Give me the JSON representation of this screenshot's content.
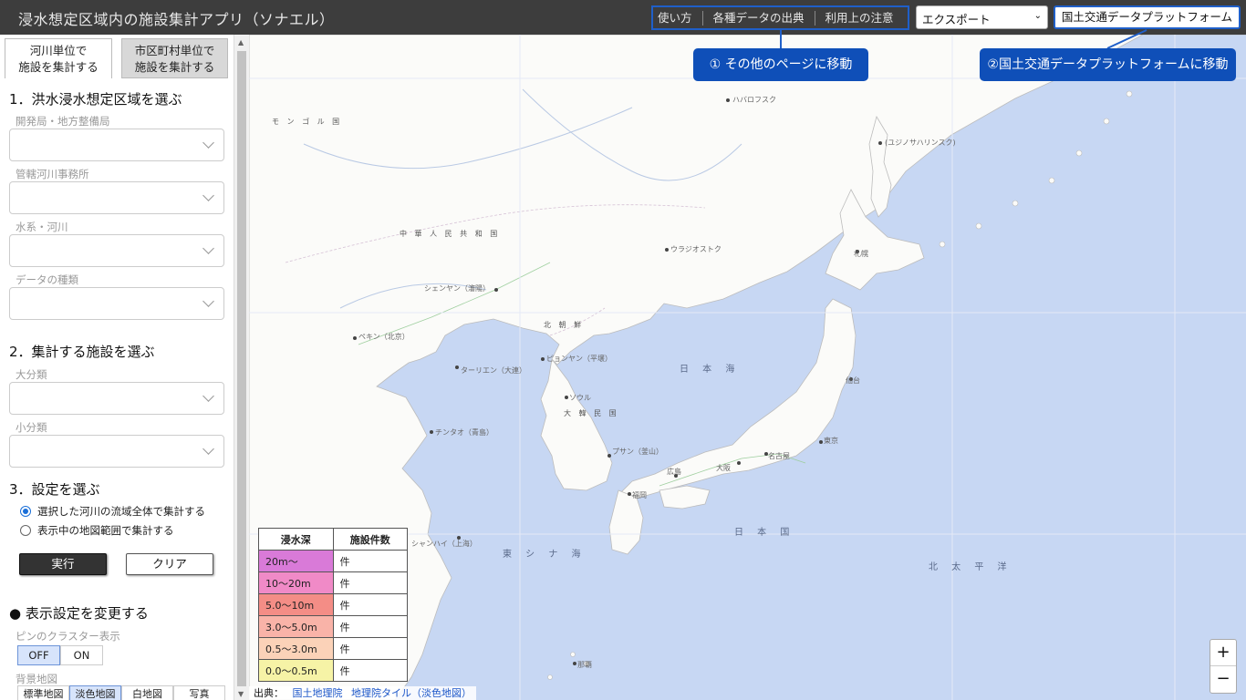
{
  "header": {
    "title": "浸水想定区域内の施設集計アプリ（ソナエル）",
    "nav": [
      "使い方",
      "各種データの出典",
      "利用上の注意"
    ],
    "export_label": "エクスポート",
    "platform_label": "国土交通データプラットフォーム"
  },
  "callouts": {
    "other_pages": "① その他のページに移動",
    "platform": "②国土交通データプラットフォームに移動"
  },
  "sidebar": {
    "tabs": [
      {
        "line1": "河川単位で",
        "line2": "施設を集計する",
        "active": true
      },
      {
        "line1": "市区町村単位で",
        "line2": "施設を集計する",
        "active": false
      }
    ],
    "step1": {
      "title": "1．洪水浸水想定区域を選ぶ",
      "fields": [
        "開発局・地方整備局",
        "管轄河川事務所",
        "水系・河川",
        "データの種類"
      ]
    },
    "step2": {
      "title": "2．集計する施設を選ぶ",
      "fields": [
        "大分類",
        "小分類"
      ]
    },
    "step3": {
      "title": "3．設定を選ぶ",
      "options": [
        {
          "label": "選択した河川の流域全体で集計する",
          "checked": true
        },
        {
          "label": "表示中の地図範囲で集計する",
          "checked": false
        }
      ]
    },
    "execute_label": "実行",
    "clear_label": "クリア",
    "display": {
      "title": "● 表示設定を変更する",
      "cluster_label": "ピンのクラスター表示",
      "off_label": "OFF",
      "on_label": "ON",
      "cluster_selected": "OFF",
      "background_label": "背景地図",
      "tiles": [
        "標準地図",
        "淡色地図",
        "白地図",
        "写真"
      ],
      "tile_selected": "淡色地図"
    }
  },
  "map": {
    "labels": {
      "mongolia": "モ ン ゴ ル 国",
      "china": "中 華 人 民 共 和 国",
      "north_korea": "北 朝 鮮",
      "korea": "大 韓 民 国",
      "sea_of_japan": "日 本 海",
      "east_china_sea": "東 シ ナ 海",
      "japan": "日 本 国",
      "pacific": "北 太 平 洋",
      "habarovsk": "ハバロフスク",
      "yuzhno": "(ユジノサハリンスク)",
      "vladivostok": "ウラジオストク",
      "shenyang": "シェンヤン（瀋陽）",
      "beijing": "ペキン（北京）",
      "dalian": "ターリエン（大連）",
      "pyongyang": "ピョンヤン（平壌）",
      "seoul": "ソウル",
      "qingdao": "チンタオ（青島）",
      "busan": "プサン（釜山）",
      "shanghai": "シャンハイ（上海）",
      "sapporo": "札幌",
      "sendai": "仙台",
      "tokyo": "東京",
      "nagoya": "名古屋",
      "osaka": "大阪",
      "hiroshima": "広島",
      "fukuoka": "福岡",
      "naha": "那覇"
    }
  },
  "legend": {
    "header_depth": "浸水深",
    "header_count": "施設件数",
    "rows": [
      {
        "range": "20m～",
        "count": "件",
        "color": "#d97ad8"
      },
      {
        "range": "10～20m",
        "count": "件",
        "color": "#f08ac7"
      },
      {
        "range": "5.0～10m",
        "count": "件",
        "color": "#f48d86"
      },
      {
        "range": "3.0～5.0m",
        "count": "件",
        "color": "#f9b3a8"
      },
      {
        "range": "0.5～3.0m",
        "count": "件",
        "color": "#fbd2b8"
      },
      {
        "range": "0.0～0.5m",
        "count": "件",
        "color": "#f6f3a6"
      }
    ]
  },
  "zoom": {
    "in": "+",
    "out": "−"
  },
  "attribution": {
    "prefix": "出典：",
    "link1": "国土地理院",
    "link2": "地理院タイル（淡色地図）"
  }
}
